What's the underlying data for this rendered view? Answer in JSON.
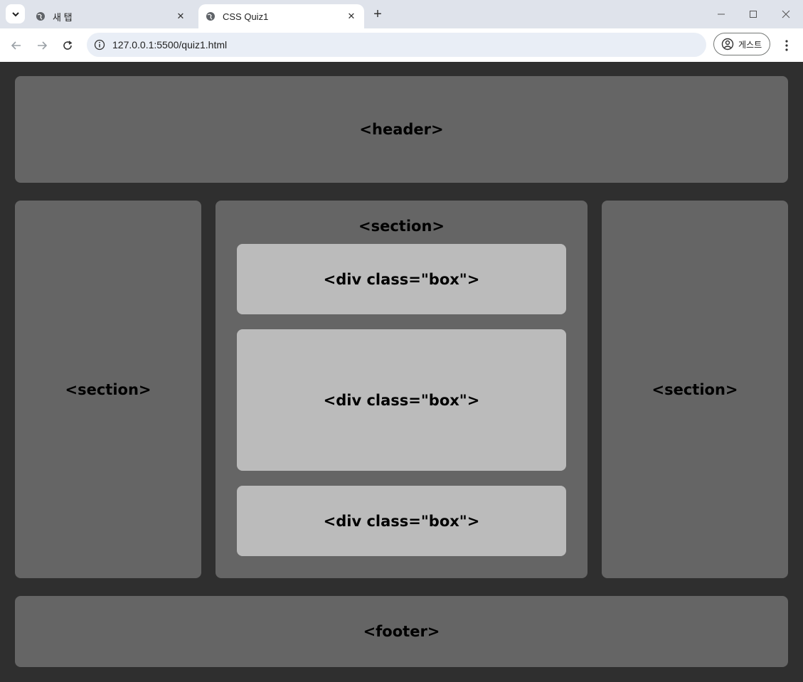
{
  "browser": {
    "tabs": [
      {
        "title": "새 탭",
        "active": false
      },
      {
        "title": "CSS Quiz1",
        "active": true
      }
    ],
    "url": "127.0.0.1:5500/quiz1.html",
    "profile_label": "게스트",
    "icons": [
      "tab-search-icon",
      "globe-icon",
      "close-icon",
      "plus-icon",
      "minimize-icon",
      "maximize-icon",
      "window-close-icon",
      "back-icon",
      "forward-icon",
      "reload-icon",
      "info-icon",
      "person-icon",
      "kebab-menu-icon"
    ]
  },
  "page": {
    "header_label": "<header>",
    "left_section_label": "<section>",
    "center_section_label": "<section>",
    "right_section_label": "<section>",
    "boxes": [
      "<div class=\"box\">",
      "<div class=\"box\">",
      "<div class=\"box\">"
    ],
    "footer_label": "<footer>"
  },
  "colors": {
    "background": "#2f2f2f",
    "block": "#656565",
    "box": "#bbbbbb"
  }
}
